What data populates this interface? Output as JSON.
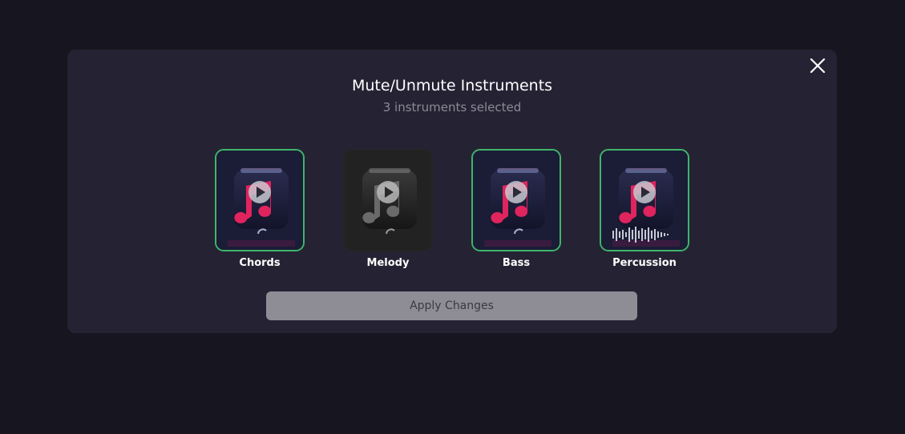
{
  "modal": {
    "title": "Mute/Unmute Instruments",
    "subtitle": "3 instruments selected",
    "close_icon": "close-icon",
    "apply_label": "Apply Changes"
  },
  "instruments": [
    {
      "label": "Chords",
      "selected": true,
      "icon": "music-note-icon"
    },
    {
      "label": "Melody",
      "selected": false,
      "icon": "music-note-icon"
    },
    {
      "label": "Bass",
      "selected": true,
      "icon": "music-note-icon"
    },
    {
      "label": "Percussion",
      "selected": true,
      "icon": "music-note-icon",
      "extra_icon": "waveform-icon"
    }
  ],
  "colors": {
    "selected_border": "#3fb56a",
    "modal_bg": "#252333",
    "page_bg": "#161520",
    "note_pink": "#e0245e",
    "apply_bg": "#8e8d96"
  }
}
